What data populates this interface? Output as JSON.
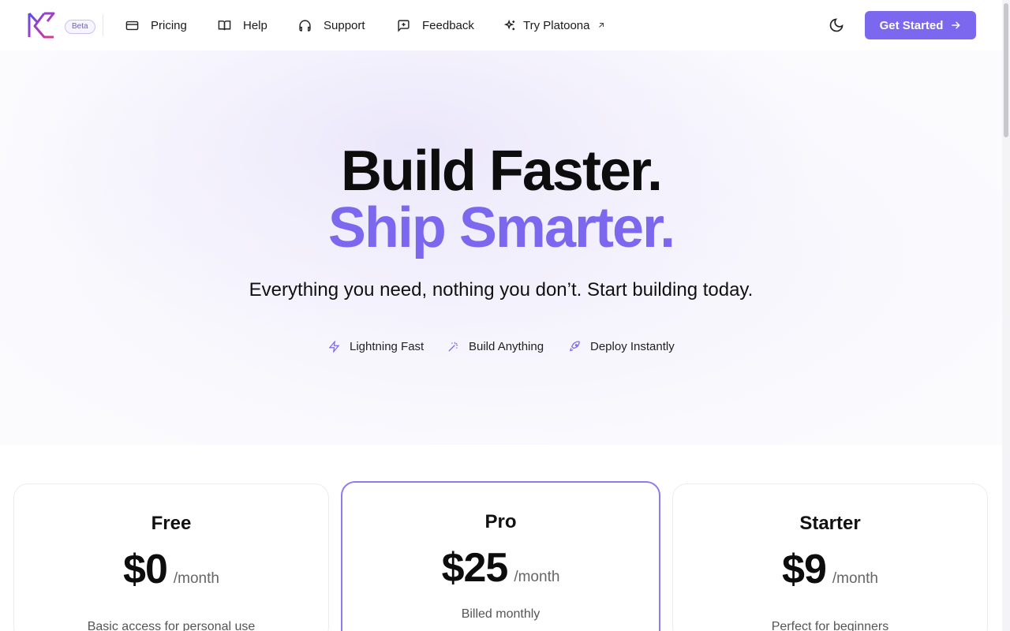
{
  "header": {
    "beta_label": "Beta",
    "nav": [
      {
        "label": "Pricing",
        "icon": "credit-card-icon"
      },
      {
        "label": "Help",
        "icon": "book-open-icon"
      },
      {
        "label": "Support",
        "icon": "headphones-icon"
      },
      {
        "label": "Feedback",
        "icon": "message-plus-icon"
      },
      {
        "label": "Try Platoona",
        "icon": "sparkles-icon"
      }
    ],
    "cta_label": "Get Started"
  },
  "hero": {
    "title_line1": "Build Faster.",
    "title_line2": "Ship Smarter.",
    "subtitle": "Everything you need, nothing you don’t. Start building today.",
    "features": [
      {
        "label": "Lightning Fast",
        "icon": "lightning-icon"
      },
      {
        "label": "Build Anything",
        "icon": "magic-wand-icon"
      },
      {
        "label": "Deploy Instantly",
        "icon": "rocket-icon"
      }
    ]
  },
  "plans": [
    {
      "name": "Free",
      "price": "$0",
      "period": "/month",
      "description": "Basic access for personal use"
    },
    {
      "name": "Pro",
      "price": "$25",
      "period": "/month",
      "description": "Billed monthly"
    },
    {
      "name": "Starter",
      "price": "$9",
      "period": "/month",
      "description": "Perfect for beginners"
    }
  ],
  "colors": {
    "accent": "#7b68ee",
    "logo_blue": "#4f46e5",
    "logo_pink": "#e6338f"
  }
}
